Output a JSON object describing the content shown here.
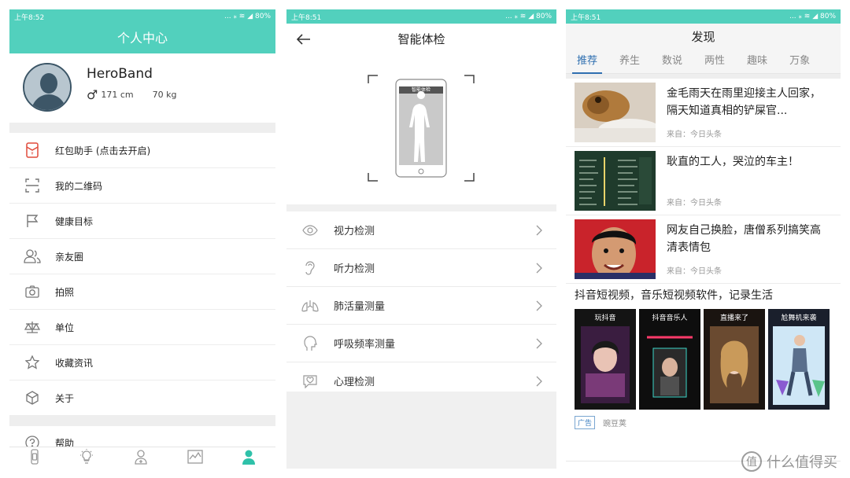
{
  "status_bars": [
    {
      "time": "上午8:52",
      "right": "... ⁎ ≋ ◢ 80%"
    },
    {
      "time": "上午8:51",
      "right": "... ⁎ ≋ ◢ 80%"
    },
    {
      "time": "上午8:51",
      "right": "... ⁎ ≋ ◢ 80%"
    }
  ],
  "profile_screen": {
    "title": "个人中心",
    "user": {
      "name": "HeroBand",
      "height": "171 cm",
      "weight": "70 kg"
    },
    "menu": [
      {
        "label": "红包助手 (点击去开启)",
        "icon": "red-envelope-icon"
      },
      {
        "label": "我的二维码",
        "icon": "qr-scan-icon"
      },
      {
        "label": "健康目标",
        "icon": "flag-icon"
      },
      {
        "label": "亲友圈",
        "icon": "friends-icon"
      },
      {
        "label": "拍照",
        "icon": "camera-icon"
      },
      {
        "label": "单位",
        "icon": "scale-icon"
      },
      {
        "label": "收藏资讯",
        "icon": "star-icon"
      },
      {
        "label": "关于",
        "icon": "cube-icon"
      }
    ],
    "help": {
      "label": "帮助",
      "icon": "help-icon"
    },
    "bottom_nav": [
      "band-icon",
      "bulb-icon",
      "health-icon",
      "chart-icon",
      "person-icon"
    ],
    "accent": "#52d0bd"
  },
  "checkup_screen": {
    "title": "智能体检",
    "phone_label": "智能体检",
    "tests": [
      {
        "label": "视力检测",
        "icon": "eye-icon"
      },
      {
        "label": "听力检测",
        "icon": "ear-icon"
      },
      {
        "label": "肺活量测量",
        "icon": "lungs-icon"
      },
      {
        "label": "呼吸频率测量",
        "icon": "head-icon"
      },
      {
        "label": "心理检测",
        "icon": "heart-chat-icon"
      }
    ]
  },
  "discover_screen": {
    "title": "发现",
    "tabs": [
      "推荐",
      "养生",
      "数说",
      "两性",
      "趣味",
      "万象"
    ],
    "active_tab": "推荐",
    "news": [
      {
        "title": "金毛雨天在雨里迎接主人回家，隔天知道真相的铲屎官...",
        "source": "来自：今日头条"
      },
      {
        "title": "耿直的工人，哭泣的车主！",
        "source": "来自：今日头条"
      },
      {
        "title": "网友自己换脸，唐僧系列搞笑高清表情包",
        "source": "来自：今日头条"
      }
    ],
    "ad": {
      "title": "抖音短视频，音乐短视频软件，记录生活",
      "cards": [
        "玩抖音",
        "抖音音乐人",
        "直播来了",
        "尬舞机来袭"
      ],
      "tag": "广告",
      "source": "豌豆荚"
    }
  },
  "watermark": {
    "symbol": "值",
    "text": "什么值得买"
  }
}
